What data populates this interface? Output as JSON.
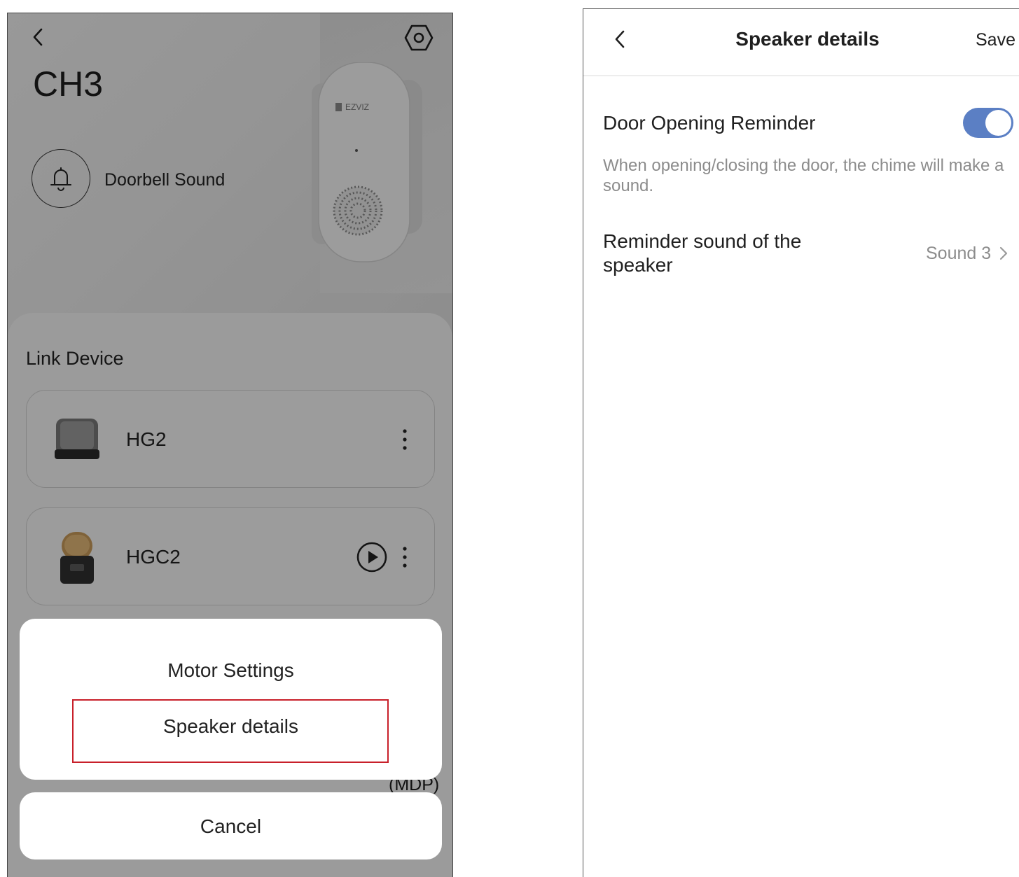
{
  "left_screen": {
    "device_title": "CH3",
    "doorbell_sound_label": "Doorbell Sound",
    "chime_brand": "EZVIZ",
    "link_section_title": "Link Device",
    "devices": [
      {
        "name": "HG2"
      },
      {
        "name": "HGC2"
      }
    ],
    "partial_label": "(MDP)",
    "action_sheet": {
      "items": [
        "Motor Settings",
        "Speaker details"
      ],
      "cancel_label": "Cancel"
    },
    "icons": {
      "back": "chevron-left-icon",
      "settings": "gear-icon",
      "bell": "bell-icon",
      "play": "play-icon",
      "more": "more-vertical-icon"
    }
  },
  "right_screen": {
    "title": "Speaker details",
    "save_label": "Save",
    "door_opening_reminder_label": "Door Opening Reminder",
    "door_opening_reminder_enabled": true,
    "description": "When opening/closing the door, the chime will make a sound.",
    "reminder_sound_label": "Reminder sound of the speaker",
    "reminder_sound_value": "Sound 3",
    "icons": {
      "back": "chevron-left-icon",
      "chevron": "chevron-right-icon"
    }
  },
  "colors": {
    "toggle_on": "#5b7fc4",
    "highlight_border": "#c8202a"
  }
}
